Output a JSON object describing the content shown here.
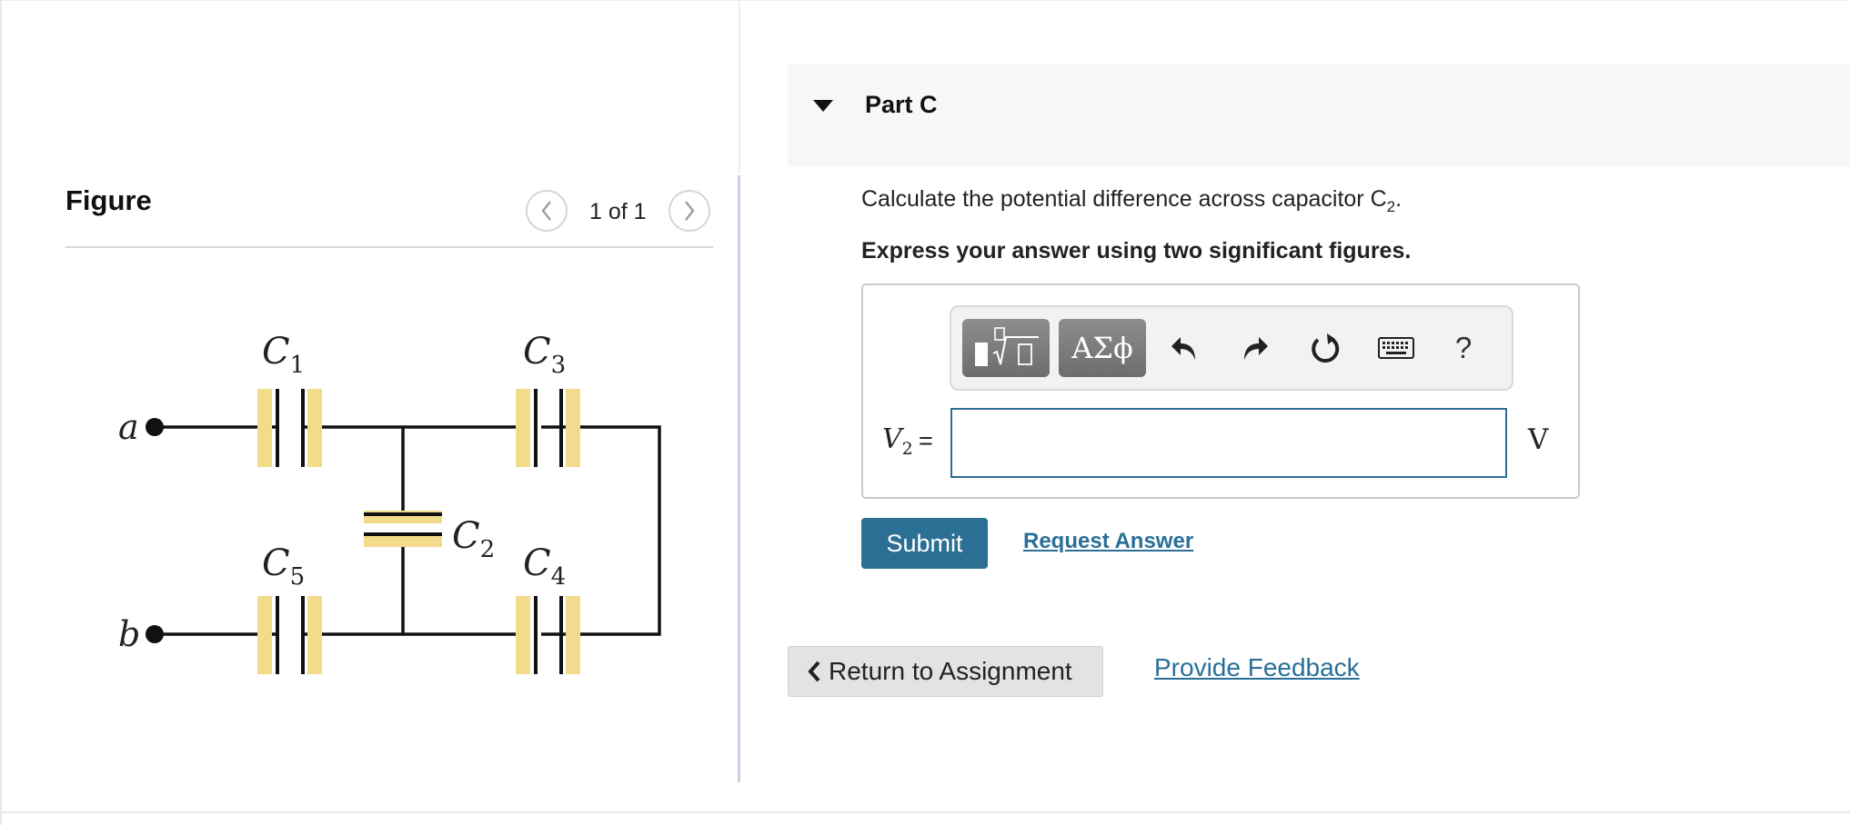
{
  "figure": {
    "title": "Figure",
    "pager": "1 of 1",
    "prev_icon": "chevron-left-icon",
    "next_icon": "chevron-right-icon",
    "circuit": {
      "terminals": [
        "a",
        "b"
      ],
      "capacitors": [
        {
          "name": "C",
          "sub": "1"
        },
        {
          "name": "C",
          "sub": "2"
        },
        {
          "name": "C",
          "sub": "3"
        },
        {
          "name": "C",
          "sub": "4"
        },
        {
          "name": "C",
          "sub": "5"
        }
      ],
      "plate_color": "#f2dc8c"
    }
  },
  "part": {
    "title": "Part C",
    "question_prefix": "Calculate the potential difference across capacitor C",
    "question_sub": "2",
    "question_suffix": ".",
    "instruction": "Express your answer using two significant figures."
  },
  "toolbar": {
    "templates_icon": "templates-icon",
    "symbols_label": "ΑΣϕ",
    "undo_icon": "undo-icon",
    "redo_icon": "redo-icon",
    "reset_icon": "reset-icon",
    "keyboard_icon": "keyboard-icon",
    "help_label": "?"
  },
  "answer": {
    "variable": "V",
    "variable_sub": "2",
    "equals": "=",
    "value": "",
    "unit": "V"
  },
  "actions": {
    "submit": "Submit",
    "request_answer": "Request Answer",
    "return": "Return to Assignment",
    "feedback": "Provide Feedback"
  },
  "colors": {
    "accent": "#2c6f94",
    "link": "#2a6f97",
    "input_border": "#2d6d93"
  }
}
